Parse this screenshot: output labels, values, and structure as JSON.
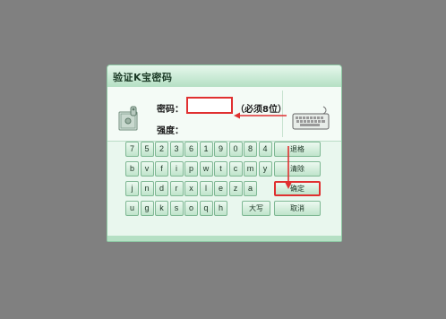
{
  "dialog": {
    "title": "验证K宝密码",
    "password_label": "密码：",
    "password_value": "",
    "password_hint": "（必须8位）",
    "strength_label": "强度：",
    "icons": {
      "safe": "safe-icon",
      "keyboard": "keyboard-icon"
    }
  },
  "keyboard": {
    "rows": [
      [
        "7",
        "5",
        "2",
        "3",
        "6",
        "1",
        "9",
        "0",
        "8",
        "4"
      ],
      [
        "b",
        "v",
        "f",
        "i",
        "p",
        "w",
        "t",
        "c",
        "m",
        "y"
      ],
      [
        "j",
        "n",
        "d",
        "r",
        "x",
        "l",
        "e",
        "z",
        "a"
      ],
      [
        "u",
        "g",
        "k",
        "s",
        "o",
        "q",
        "h"
      ]
    ],
    "backspace": "退格",
    "clear": "清除",
    "confirm": "确定",
    "caps": "大写",
    "cancel": "取消"
  },
  "colors": {
    "accent": "#e03030",
    "key_face": "#bfe4cb",
    "title_bg": "#b5e0c4",
    "background": "#808080"
  }
}
